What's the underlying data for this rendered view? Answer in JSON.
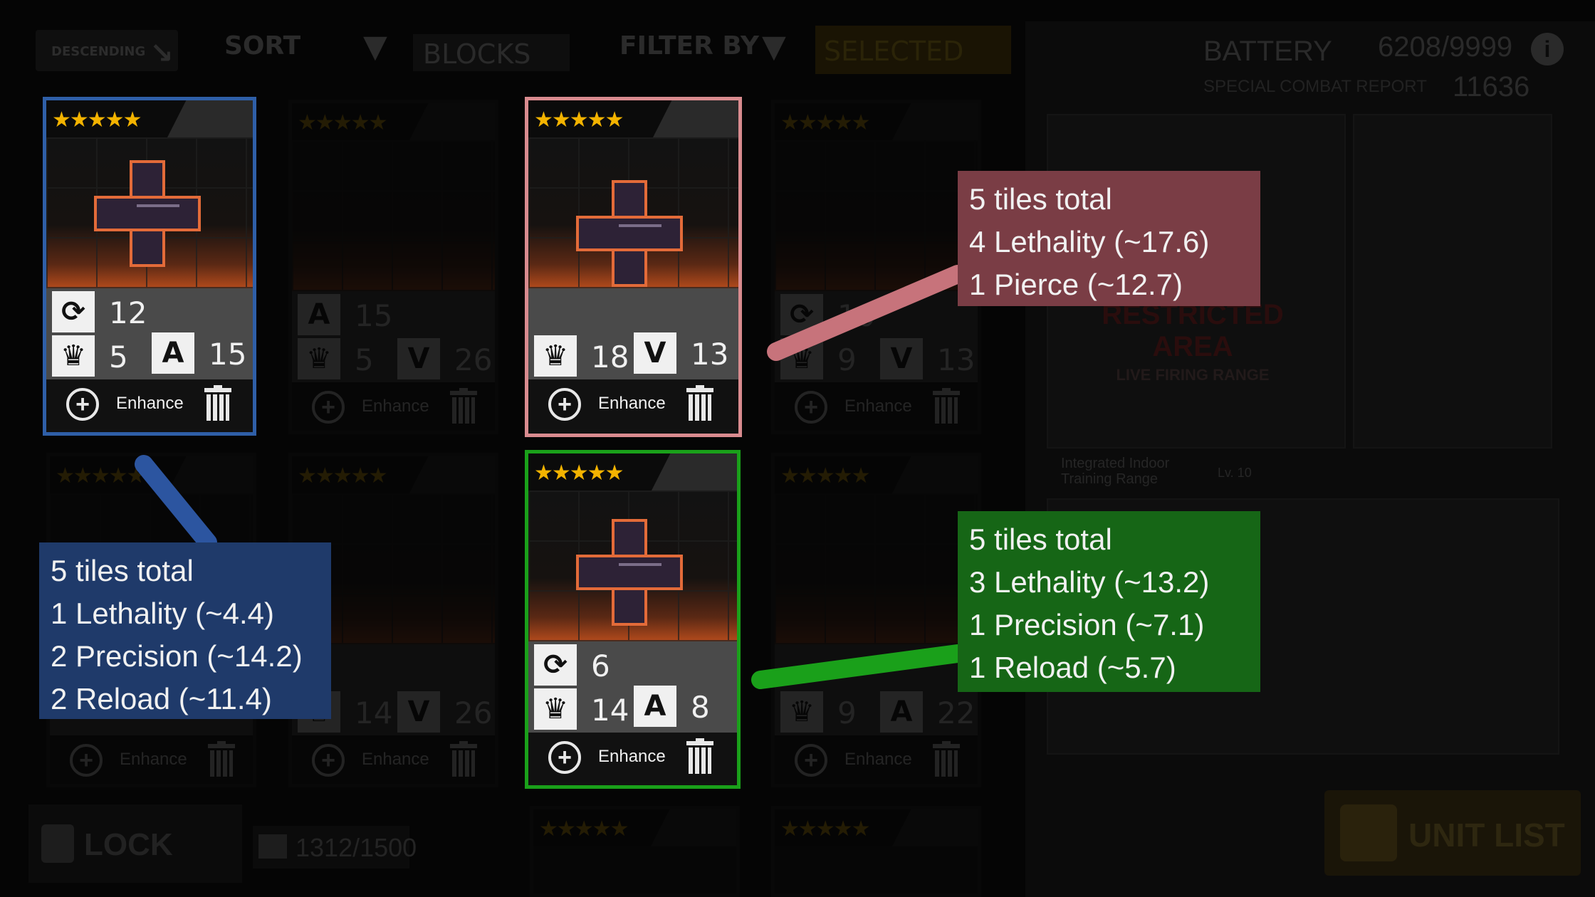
{
  "topbar": {
    "sort_direction": "DESCENDING",
    "sort_label": "SORT",
    "sort_value": "BLOCKS",
    "filter_label": "FILTER BY",
    "filter_value": "SELECTED"
  },
  "resource": {
    "battery_label": "BATTERY",
    "battery_value": "6208/9999",
    "report_label": "SPECIAL COMBAT REPORT",
    "report_value": "11636",
    "info_icon": "i"
  },
  "right_panel": {
    "restricted_title": "RESTRICTED AREA",
    "restricted_sub": "LIVE FIRING RANGE",
    "range_name_line1": "Integrated Indoor",
    "range_name_line2": "Training Range",
    "range_level": "Lv. 10",
    "unit_list_label": "UNIT LIST"
  },
  "bottom": {
    "lock_label": "LOCK",
    "capacity": "1312/1500"
  },
  "cards": {
    "blue": {
      "stars": "★★★★★",
      "stat1_icon": "⟳",
      "stat1_value": "12",
      "stat2_icon": "♛",
      "stat2_value": "5",
      "stat3_icon": "A",
      "stat3_value": "15",
      "enhance_label": "Enhance"
    },
    "pink": {
      "stars": "★★★★★",
      "stat1_icon": "♛",
      "stat1_value": "18",
      "stat2_icon": "V",
      "stat2_value": "13",
      "enhance_label": "Enhance"
    },
    "green": {
      "stars": "★★★★★",
      "stat1_icon": "⟳",
      "stat1_value": "6",
      "stat2_icon": "♛",
      "stat2_value": "14",
      "stat3_icon": "A",
      "stat3_value": "8",
      "enhance_label": "Enhance"
    },
    "dim": {
      "stars": "★★★★★",
      "enhance_label": "Enhance",
      "c2_v1": "15",
      "c2_v2": "5",
      "c2_v3": "26",
      "c4_v1": "10",
      "c4_v2": "9",
      "c4_v3": "13",
      "c6_v1": "14",
      "c6_v2": "26",
      "c8_v1": "9",
      "c8_v2": "22"
    }
  },
  "callouts": {
    "pink": [
      "5 tiles total",
      "4 Lethality (~17.6)",
      "1 Pierce (~12.7)"
    ],
    "green": [
      "5 tiles total",
      "3 Lethality (~13.2)",
      "1 Precision (~7.1)",
      "1 Reload (~5.7)"
    ],
    "blue": [
      "5 tiles total",
      "1 Lethality (~4.4)",
      "2 Precision (~14.2)",
      "2 Reload (~11.4)"
    ]
  },
  "colors": {
    "blue_accent": "#2f5fa8",
    "pink_accent": "#d98b8f",
    "green_accent": "#1aa01a",
    "star": "#f3b300",
    "tile_outline": "#e36b39"
  }
}
